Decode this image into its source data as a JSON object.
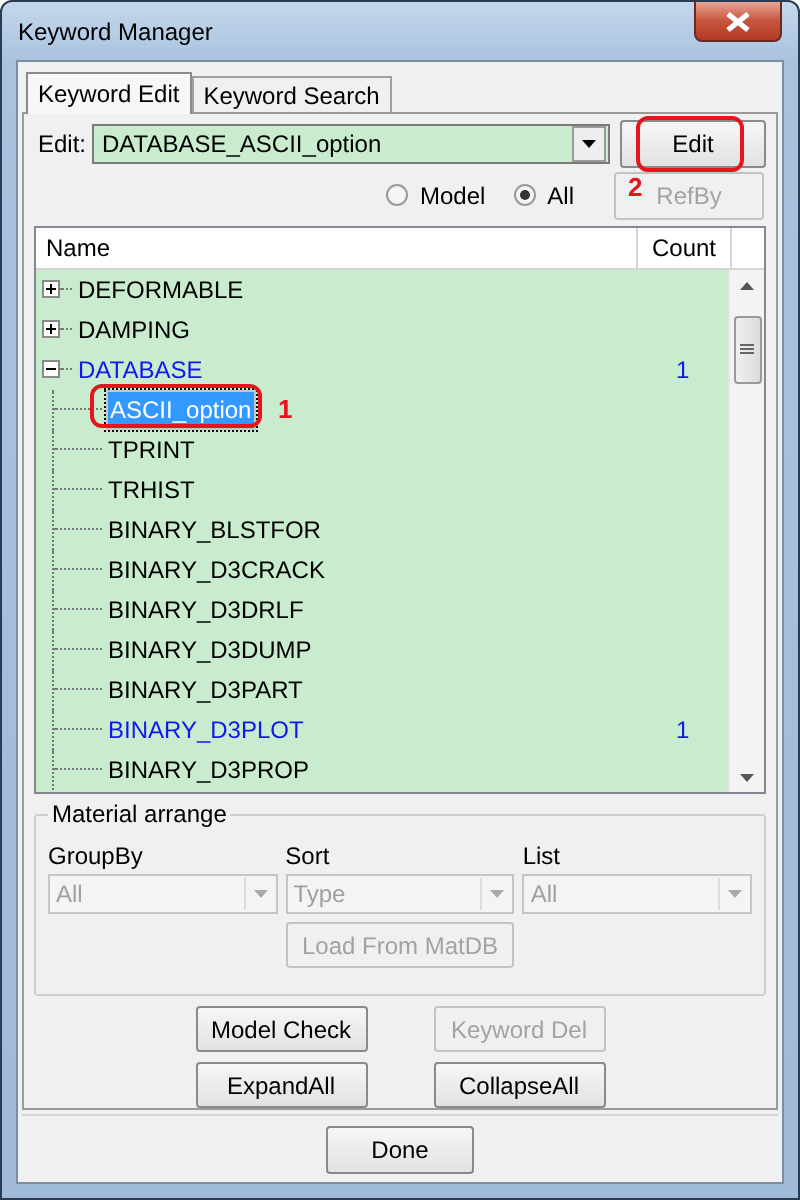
{
  "window": {
    "title": "Keyword Manager"
  },
  "tabs": [
    {
      "label": "Keyword Edit",
      "selected": true
    },
    {
      "label": "Keyword Search",
      "selected": false
    }
  ],
  "edit": {
    "label": "Edit:",
    "value": "DATABASE_ASCII_option"
  },
  "edit_button": {
    "label": "Edit",
    "disabled": false,
    "annotation": "2"
  },
  "refby_button": {
    "label": "RefBy",
    "disabled": true
  },
  "radios": [
    {
      "label": "Model",
      "selected": false
    },
    {
      "label": "All",
      "selected": true
    }
  ],
  "tree": {
    "columns": [
      "Name",
      "Count"
    ],
    "items": [
      {
        "name": "DEFORMABLE",
        "expanded": false,
        "highlighted": false,
        "selected": false
      },
      {
        "name": "DAMPING",
        "expanded": false,
        "highlighted": false,
        "selected": false
      },
      {
        "name": "DATABASE",
        "expanded": true,
        "highlighted": true,
        "selected": false,
        "count": "1",
        "children": [
          {
            "name": "ASCII_option",
            "highlighted": false,
            "selected": true,
            "annotation": "1"
          },
          {
            "name": "TPRINT",
            "highlighted": false,
            "selected": false
          },
          {
            "name": "TRHIST",
            "highlighted": false,
            "selected": false
          },
          {
            "name": "BINARY_BLSTFOR",
            "highlighted": false,
            "selected": false
          },
          {
            "name": "BINARY_D3CRACK",
            "highlighted": false,
            "selected": false
          },
          {
            "name": "BINARY_D3DRLF",
            "highlighted": false,
            "selected": false
          },
          {
            "name": "BINARY_D3DUMP",
            "highlighted": false,
            "selected": false
          },
          {
            "name": "BINARY_D3PART",
            "highlighted": false,
            "selected": false
          },
          {
            "name": "BINARY_D3PLOT",
            "highlighted": true,
            "selected": false,
            "count": "1"
          },
          {
            "name": "BINARY_D3PROP",
            "highlighted": false,
            "selected": false
          }
        ]
      }
    ]
  },
  "material": {
    "title": "Material arrange",
    "fields": [
      {
        "label": "GroupBy",
        "value": "All",
        "disabled": true
      },
      {
        "label": "Sort",
        "value": "Type",
        "disabled": true
      },
      {
        "label": "List",
        "value": "All",
        "disabled": true
      }
    ],
    "load_button": {
      "label": "Load From MatDB",
      "disabled": true
    }
  },
  "buttons": [
    {
      "label": "Model Check",
      "disabled": false
    },
    {
      "label": "Keyword Del",
      "disabled": true
    },
    {
      "label": "ExpandAll",
      "disabled": false
    },
    {
      "label": "CollapseAll",
      "disabled": false
    }
  ],
  "done_button": {
    "label": "Done",
    "disabled": false
  }
}
